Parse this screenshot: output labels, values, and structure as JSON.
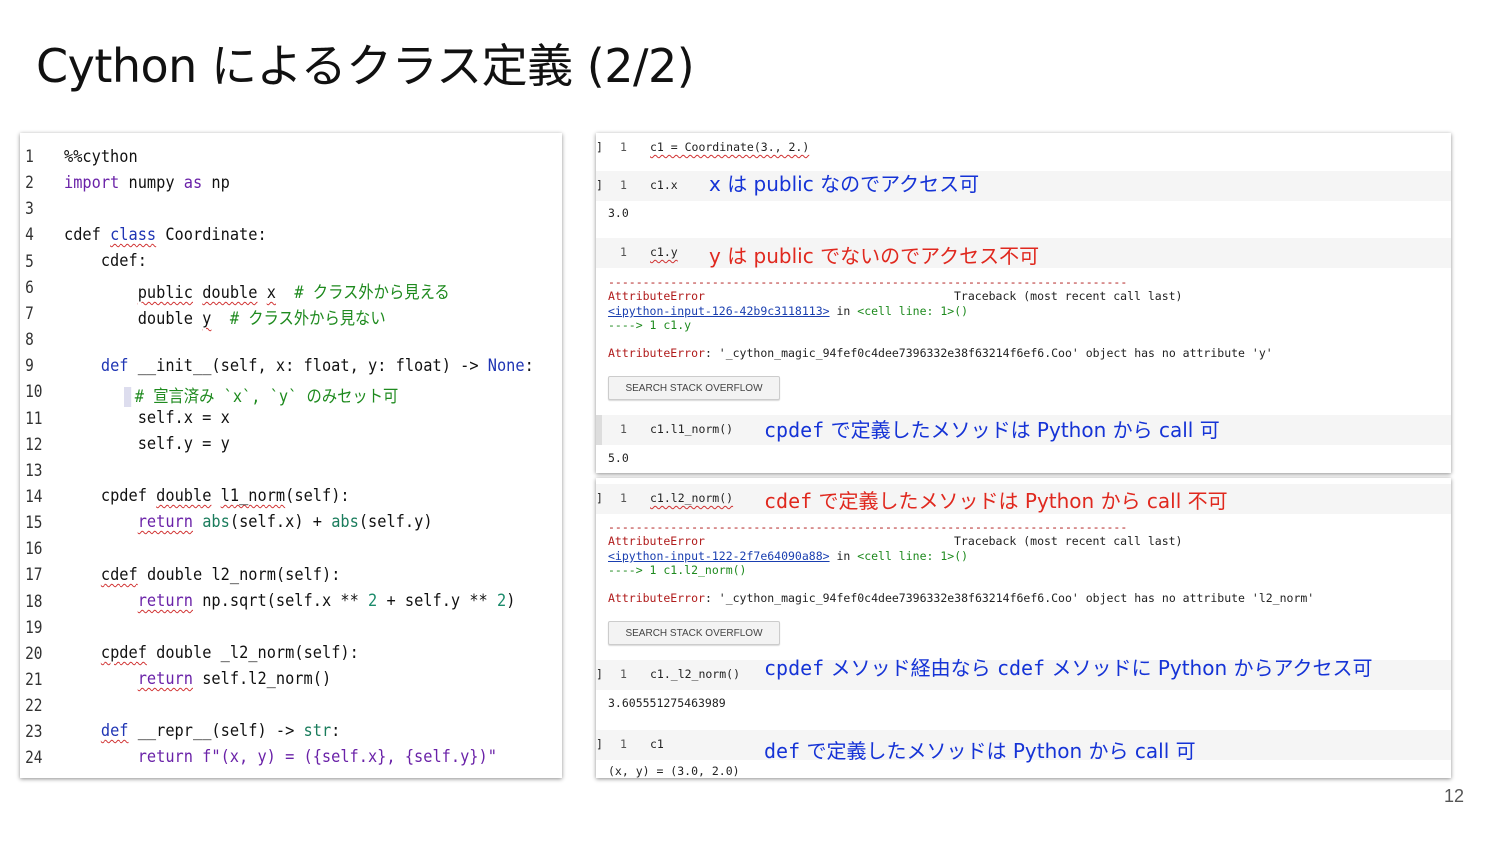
{
  "title": "Cython によるクラス定義 (2/2)",
  "page_number": "12",
  "code_lines": [
    {
      "n": "1"
    },
    {
      "n": "2"
    },
    {
      "n": "3"
    },
    {
      "n": "4"
    },
    {
      "n": "5"
    },
    {
      "n": "6"
    },
    {
      "n": "7"
    },
    {
      "n": "8"
    },
    {
      "n": "9"
    },
    {
      "n": "10"
    },
    {
      "n": "11"
    },
    {
      "n": "12"
    },
    {
      "n": "13"
    },
    {
      "n": "14"
    },
    {
      "n": "15"
    },
    {
      "n": "16"
    },
    {
      "n": "17"
    },
    {
      "n": "18"
    },
    {
      "n": "19"
    },
    {
      "n": "20"
    },
    {
      "n": "21"
    },
    {
      "n": "22"
    },
    {
      "n": "23"
    },
    {
      "n": "24"
    }
  ],
  "code": {
    "l1": "%%cython",
    "l2a": "import",
    "l2b": " numpy ",
    "l2c": "as",
    "l2d": " np",
    "l4a": "cdef ",
    "l4b": "class",
    "l4c": " Coordinate:",
    "l5": "    cdef:",
    "l6a": "        ",
    "l6b": "public",
    "l6c": " ",
    "l6d": "double",
    "l6e": " ",
    "l6f": "x",
    "l6g": "  # クラス外から見える",
    "l7a": "        double ",
    "l7b": "y",
    "l7c": "  # クラス外から見ない",
    "l9a": "    ",
    "l9b": "def",
    "l9c": " __init__(self, x: float, y: float) -> ",
    "l9d": "None",
    "l9e": ":",
    "l10": "# 宣言済み `x`, `y` のみセット可",
    "l11": "        self.x = x",
    "l12": "        self.y = y",
    "l14a": "    ",
    "l14b": "cpdef",
    "l14c": " ",
    "l14d": "double",
    "l14e": " ",
    "l14f": "l1_norm",
    "l14g": "(self):",
    "l15a": "        ",
    "l15b": "return",
    "l15c": " ",
    "l15d": "abs",
    "l15e": "(self.x) + ",
    "l15f": "abs",
    "l15g": "(self.y)",
    "l17a": "    ",
    "l17b": "cdef",
    "l17c": " ",
    "l17d": "double",
    "l17e": " ",
    "l17f": "l2_norm",
    "l17g": "(self):",
    "l18a": "        ",
    "l18b": "return",
    "l18c": " np.sqrt(self.x ** ",
    "l18d": "2",
    "l18e": " + self.y ** ",
    "l18f": "2",
    "l18g": ")",
    "l20a": "    ",
    "l20b": "cpdef",
    "l20c": " ",
    "l20d": "double",
    "l20e": " ",
    "l20f": "_l2_norm",
    "l20g": "(self):",
    "l21a": "        ",
    "l21b": "return",
    "l21c": " self.l2_norm()",
    "l23a": "    ",
    "l23b": "def",
    "l23c": " __repr__(self) -> ",
    "l23d": "str",
    "l23e": ":",
    "l24a": "        return f\"(x, y) = ({self.x}, {self.y})\""
  },
  "nb": {
    "c1_src": "c1 = Coordinate(3., 2.)",
    "c2_src": "c1.x",
    "c2_out": "3.0",
    "c3_src": "c1.y",
    "err1_line": "---------------------------------------------------------------------------",
    "err1_name": "AttributeError",
    "err1_tb": "Traceback (most recent call last)",
    "err1_link": "<ipython-input-126-42b9c3118113>",
    "err1_in": " in ",
    "err1_cell": "<cell line: 1>()",
    "err1_arrow": "----> 1 c1.y",
    "err1_msg_name": "AttributeError",
    "err1_msg": ": '_cython_magic_94fef0c4dee7396332e38f63214f6ef6.Coo' object has no attribute 'y'",
    "so_btn": "SEARCH STACK OVERFLOW",
    "c4_src": "c1.l1_norm()",
    "c4_out": "5.0",
    "c5_src": "c1.l2_norm()",
    "err2_link": "<ipython-input-122-2f7e64090a88>",
    "err2_arrow": "----> 1 c1.l2_norm()",
    "err2_msg": ": '_cython_magic_94fef0c4dee7396332e38f63214f6ef6.Coo' object has no attribute 'l2_norm'",
    "c6_src": "c1._l2_norm()",
    "c6_out": "3.605551275463989",
    "c7_src": "c1",
    "c7_out": "(x, y) = (3.0, 2.0)",
    "line_no": "1",
    "prompt": "]"
  },
  "notes": {
    "n1": "x は public なのでアクセス可",
    "n2": "y は public でないのでアクセス不可",
    "n3a": "cpdef",
    "n3b": " で定義したメソッドは Python から call 可",
    "n4a": "cdef",
    "n4b": " で定義したメソッドは Python から call 不可",
    "n5a": "cpdef",
    "n5b": " メソッド経由なら ",
    "n5c": "cdef",
    "n5d": " メソッドに Python からアクセス可",
    "n6a": "def",
    "n6b": " で定義したメソッドは Python から call 可"
  },
  "colors": {
    "note_blue": "#1533d6",
    "note_red": "#e0281e",
    "keyword": "#1f35b4",
    "comment": "#1e8a1e"
  }
}
